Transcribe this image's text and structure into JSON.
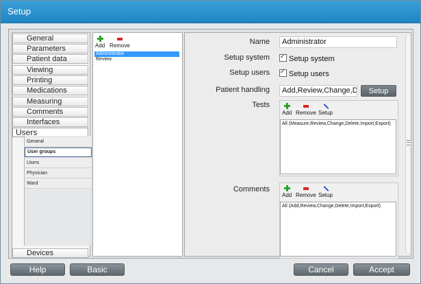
{
  "window": {
    "title": "Setup"
  },
  "nav": {
    "items": [
      {
        "label": "General"
      },
      {
        "label": "Parameters"
      },
      {
        "label": "Patient data"
      },
      {
        "label": "Viewing"
      },
      {
        "label": "Printing"
      },
      {
        "label": "Medications"
      },
      {
        "label": "Measuring"
      },
      {
        "label": "Comments"
      },
      {
        "label": "Interfaces"
      },
      {
        "label": "Users"
      }
    ],
    "subitems": [
      {
        "label": "General"
      },
      {
        "label": "User groups"
      },
      {
        "label": "Users"
      },
      {
        "label": "Physician"
      },
      {
        "label": "Ward"
      }
    ],
    "bottom_item": {
      "label": "Devices"
    }
  },
  "list_pane": {
    "add_label": "Add",
    "remove_label": "Remove",
    "items": [
      "Administrator",
      "Review"
    ]
  },
  "form": {
    "name_label": "Name",
    "name_value": "Administrator",
    "setup_system_label": "Setup system",
    "setup_system_check": "Setup system",
    "setup_users_label": "Setup users",
    "setup_users_check": "Setup users",
    "patient_handling_label": "Patient handling",
    "patient_handling_value": "Add,Review,Change,De",
    "setup_button": "Setup",
    "tests_label": "Tests",
    "tests_add": "Add",
    "tests_remove": "Remove",
    "tests_setup": "Setup",
    "tests_box": "All (Measure,Review,Change,Delete,Import,Export)",
    "comments_label": "Comments",
    "comments_add": "Add",
    "comments_remove": "Remove",
    "comments_setup": "Setup",
    "comments_box": "All (Add,Review,Change,Delete,Import,Export)"
  },
  "footer": {
    "help": "Help",
    "basic": "Basic",
    "cancel": "Cancel",
    "accept": "Accept"
  },
  "colors": {
    "titlebar": "#1f86c4",
    "selection": "#3399ff"
  },
  "icons": [
    "add-plus-icon",
    "remove-minus-icon",
    "setup-wrench-icon",
    "scroll-grip-icon"
  ]
}
